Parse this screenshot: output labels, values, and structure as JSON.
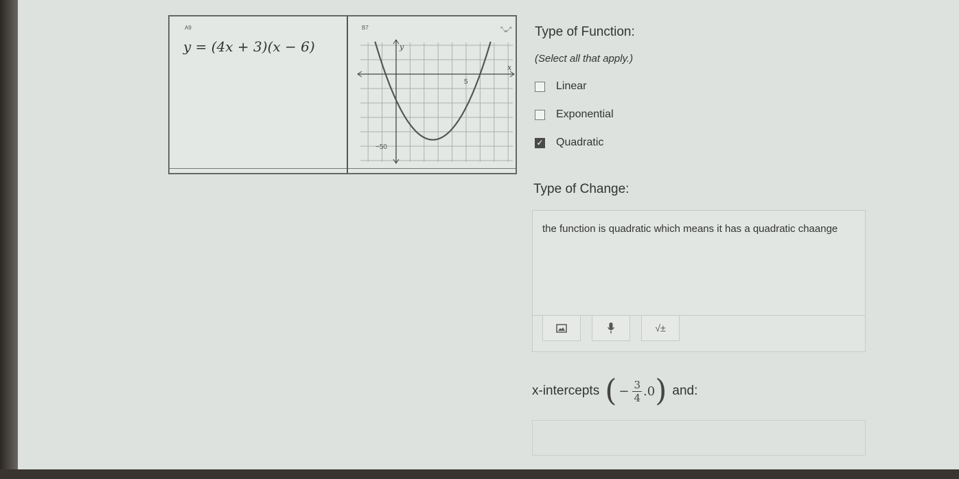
{
  "table": {
    "cell_a_tag": "A9",
    "equation": "y = (4x + 3)(x − 6)",
    "cell_b_tag": "B7",
    "graph": {
      "x_axis_label": "x",
      "y_axis_label": "y",
      "x_tick_label": "5",
      "y_tick_label": "−50",
      "curve_color": "#555555"
    }
  },
  "type_of_function": {
    "title": "Type of Function:",
    "subtitle": "(Select all that apply.)",
    "options": [
      {
        "label": "Linear",
        "checked": false
      },
      {
        "label": "Exponential",
        "checked": false
      },
      {
        "label": "Quadratic",
        "checked": true
      }
    ]
  },
  "type_of_change": {
    "title": "Type of Change:",
    "answer": "the function is quadratic which means it has a quadratic chaange",
    "toolbar": [
      "image-icon",
      "microphone-icon",
      "math-icon"
    ],
    "math_label": "√±"
  },
  "x_intercepts": {
    "label": "x-intercepts",
    "numerator": "3",
    "denominator": "4",
    "minus": "−",
    "after": ".0",
    "suffix": "and:"
  }
}
